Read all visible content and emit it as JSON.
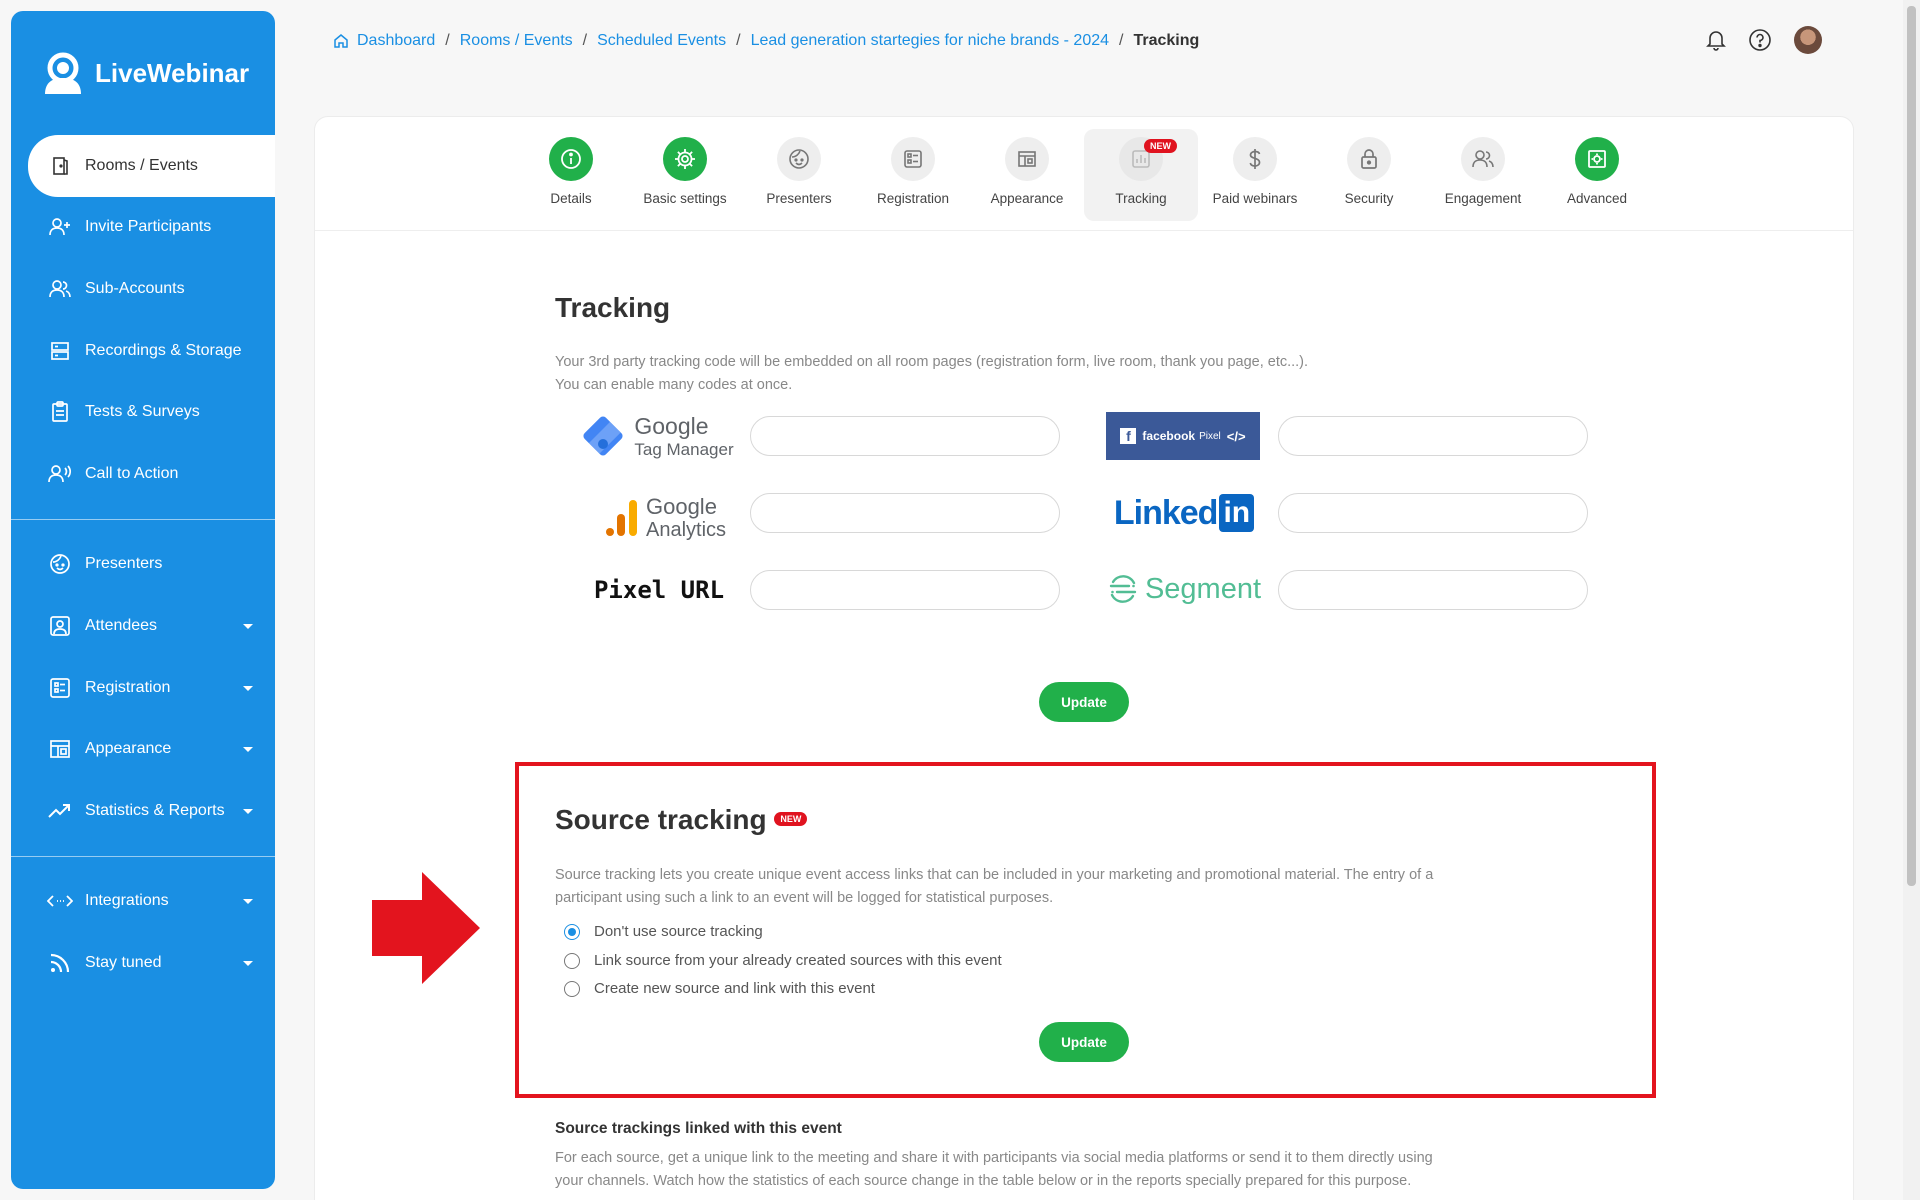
{
  "app": {
    "name": "LiveWebinar"
  },
  "sidebar": {
    "items": [
      {
        "label": "Rooms / Events",
        "icon": "door-icon",
        "active": true
      },
      {
        "label": "Invite Participants",
        "icon": "add-user-icon"
      },
      {
        "label": "Sub-Accounts",
        "icon": "users-icon"
      },
      {
        "label": "Recordings & Storage",
        "icon": "storage-icon"
      },
      {
        "label": "Tests & Surveys",
        "icon": "clipboard-icon"
      },
      {
        "label": "Call to Action",
        "icon": "speaker-icon"
      }
    ],
    "items2": [
      {
        "label": "Presenters",
        "icon": "presenter-face-icon"
      },
      {
        "label": "Attendees",
        "icon": "attendees-icon",
        "dropdown": true
      },
      {
        "label": "Registration",
        "icon": "registration-icon",
        "dropdown": true
      },
      {
        "label": "Appearance",
        "icon": "layout-icon",
        "dropdown": true
      },
      {
        "label": "Statistics & Reports",
        "icon": "trend-icon",
        "dropdown": true
      }
    ],
    "items3": [
      {
        "label": "Integrations",
        "icon": "code-arrows-icon",
        "dropdown": true
      },
      {
        "label": "Stay tuned",
        "icon": "rss-icon",
        "dropdown": true
      }
    ]
  },
  "breadcrumb": {
    "items": [
      "Dashboard",
      "Rooms / Events",
      "Scheduled Events",
      "Lead generation startegies for niche brands - 2024"
    ],
    "current": "Tracking"
  },
  "tabs": [
    {
      "label": "Details",
      "icon": "info-icon",
      "done": true
    },
    {
      "label": "Basic settings",
      "icon": "gear-icon",
      "done": true
    },
    {
      "label": "Presenters",
      "icon": "presenter-face-icon"
    },
    {
      "label": "Registration",
      "icon": "registration-icon"
    },
    {
      "label": "Appearance",
      "icon": "layout-icon"
    },
    {
      "label": "Tracking",
      "icon": "tracking-icon",
      "active": true,
      "badge": "NEW"
    },
    {
      "label": "Paid webinars",
      "icon": "dollar-icon"
    },
    {
      "label": "Security",
      "icon": "lock-icon"
    },
    {
      "label": "Engagement",
      "icon": "engagement-icon"
    },
    {
      "label": "Advanced",
      "icon": "advanced-icon",
      "done": true
    }
  ],
  "tracking": {
    "title": "Tracking",
    "desc_line1": "Your 3rd party tracking code will be embedded on all room pages (registration form, live room, thank you page, etc...).",
    "desc_line2": "You can enable many codes at once.",
    "gtm_line1": "Google",
    "gtm_line2": "Tag Manager",
    "ga_line1": "Google",
    "ga_line2": "Analytics",
    "pixel_url": "Pixel URL",
    "fb_text": "facebook",
    "fb_pixel": "Pixel",
    "fb_code": "</>",
    "linkedin_text": "Linked",
    "linkedin_in": "in",
    "segment_text": "Segment",
    "gtm_value": "",
    "ga_value": "",
    "pixel_value": "",
    "fb_value": "",
    "linkedin_value": "",
    "segment_value": "",
    "update_label": "Update"
  },
  "source_tracking": {
    "title": "Source tracking",
    "badge": "NEW",
    "desc_line1": "Source tracking lets you create unique event access links that can be included in your marketing and promotional material. The entry of a",
    "desc_line2": "participant using such a link to an event will be logged for statistical purposes.",
    "options": [
      {
        "label": "Don't use source tracking",
        "checked": true
      },
      {
        "label": "Link source from your already created sources with this event",
        "checked": false
      },
      {
        "label": "Create new source and link with this event",
        "checked": false
      }
    ],
    "update_label": "Update"
  },
  "linked": {
    "title": "Source trackings linked with this event",
    "desc_line1": "For each source, get a unique link to the meeting and share it with participants via social media platforms or send it to them directly using",
    "desc_line2": "your channels. Watch how the statistics of each source change in the table below or in the reports specially prepared for this purpose."
  },
  "colors": {
    "brand": "#1a8fe3",
    "success": "#21b04a",
    "alert": "#e3141e"
  }
}
